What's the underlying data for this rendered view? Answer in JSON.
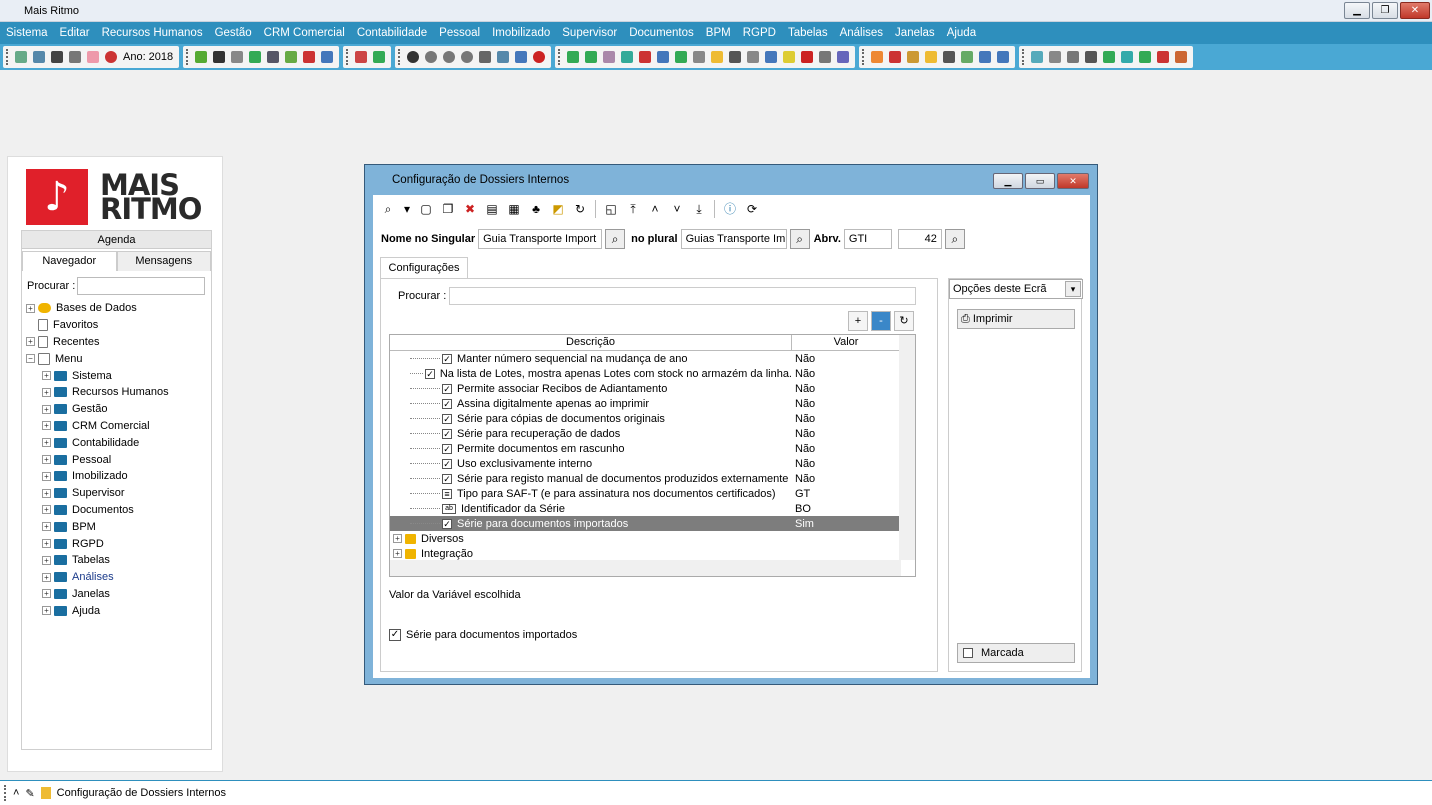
{
  "app": {
    "title": "Mais Ritmo"
  },
  "menu": [
    "Sistema",
    "Editar",
    "Recursos Humanos",
    "Gestão",
    "CRM Comercial",
    "Contabilidade",
    "Pessoal",
    "Imobilizado",
    "Supervisor",
    "Documentos",
    "BPM",
    "RGPD",
    "Tabelas",
    "Análises",
    "Janelas",
    "Ajuda"
  ],
  "toolbar": {
    "year_label": "Ano: 2018"
  },
  "logo": {
    "line1": "MAIS",
    "line2": "RITMO"
  },
  "nav": {
    "agenda": "Agenda",
    "tab_nav": "Navegador",
    "tab_msg": "Mensagens",
    "search_label": "Procurar :",
    "items": [
      "Bases de Dados",
      "Favoritos",
      "Recentes",
      "Menu"
    ],
    "menu_items": [
      "Sistema",
      "Recursos Humanos",
      "Gestão",
      "CRM Comercial",
      "Contabilidade",
      "Pessoal",
      "Imobilizado",
      "Supervisor",
      "Documentos",
      "BPM",
      "RGPD",
      "Tabelas",
      "Análises",
      "Janelas",
      "Ajuda"
    ]
  },
  "dialog": {
    "title": "Configuração de Dossiers Internos",
    "nome_label": "Nome no Singular",
    "nome_value": "Guia Transporte Import",
    "plural_label": "no plural",
    "plural_value": "Guias Transporte Imp",
    "abrv_label": "Abrv.",
    "abrv_value": "GTI",
    "number": "42",
    "tab": "Configurações",
    "search_label": "Procurar :",
    "col_desc": "Descrição",
    "col_val": "Valor",
    "rows": [
      {
        "d": "Manter número sequencial na mudança de ano",
        "v": "Não"
      },
      {
        "d": "Na lista de Lotes, mostra apenas Lotes com stock no armazém da linha.",
        "v": "Não"
      },
      {
        "d": "Permite associar Recibos de Adiantamento",
        "v": "Não"
      },
      {
        "d": "Assina digitalmente apenas ao imprimir",
        "v": "Não"
      },
      {
        "d": "Série para cópias de documentos originais",
        "v": "Não"
      },
      {
        "d": "Série para recuperação de dados",
        "v": "Não"
      },
      {
        "d": "Permite documentos em rascunho",
        "v": "Não"
      },
      {
        "d": "Uso exclusivamente interno",
        "v": "Não"
      },
      {
        "d": "Série para registo manual de documentos produzidos externamente",
        "v": "Não"
      },
      {
        "d": "Tipo para SAF-T (e para assinatura nos documentos certificados)",
        "v": "GT"
      },
      {
        "d": "Identificador da Série",
        "v": "BO"
      },
      {
        "d": "Série para documentos importados",
        "v": "Sim"
      }
    ],
    "folders": [
      "Diversos",
      "Integração"
    ],
    "value_label": "Valor da Variável escolhida",
    "checkbox_label": "Série para documentos importados",
    "options_label": "Opções deste Ecrã",
    "print_label": "Imprimir",
    "marked_label": "Marcada"
  },
  "status": {
    "window": "Configuração de Dossiers Internos"
  }
}
